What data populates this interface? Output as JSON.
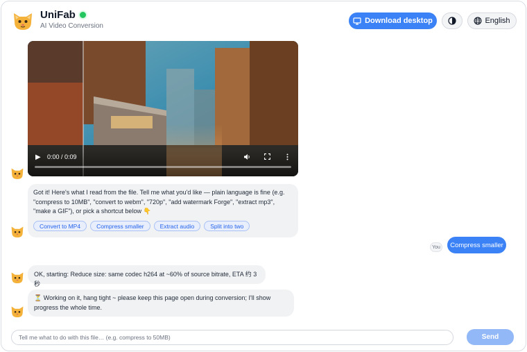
{
  "header": {
    "app_name": "UniFab",
    "subtitle": "AI Video Conversion",
    "download_label": "Download desktop",
    "language_label": "English"
  },
  "video": {
    "time_display": "0:00 / 0:09",
    "progress_fraction": 0
  },
  "messages": {
    "bot_intro": "Got it! Here's what I read from the file. Tell me what you'd like — plain language is fine (e.g. \"compress to 10MB\", \"convert to webm\", \"720p\", \"add watermark Forge\", \"extract mp3\", \"make a GIF\"), or pick a shortcut below 👇",
    "shortcuts": [
      "Convert to MP4",
      "Compress smaller",
      "Extract audio",
      "Split into two"
    ],
    "user_label": "You",
    "user_message": "Compress smaller",
    "bot_starting": "OK, starting: Reduce size: same codec h264 at ~60% of source bitrate, ETA 约 3 秒",
    "bot_working_icon": "⏳",
    "bot_working": "Working on it, hang tight ~ please keep this page open during conversion; I'll show progress the whole time."
  },
  "composer": {
    "placeholder": "Tell me what to do with this file… (e.g. compress to 50MB)",
    "send_label": "Send"
  },
  "colors": {
    "accent": "#3b82f6",
    "send_disabled": "#93b8f7",
    "status_online": "#22c55e",
    "chip_text": "#2563eb",
    "bubble_bg": "#f1f2f4"
  }
}
